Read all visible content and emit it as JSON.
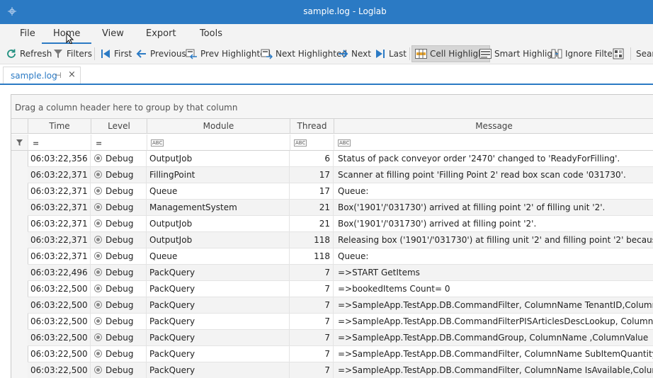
{
  "window": {
    "title": "sample.log - Loglab"
  },
  "menu": {
    "items": [
      "File",
      "Home",
      "View",
      "Export",
      "Tools"
    ],
    "active": "Home"
  },
  "toolbar": {
    "refresh": "Refresh",
    "filters": "Filters",
    "first": "First",
    "previous": "Previous",
    "prev_highlighted": "Prev Highlighted",
    "next_highlighted": "Next Highlighted",
    "next": "Next",
    "last": "Last",
    "cell_highlight": "Cell Highlight",
    "smart_highlight": "Smart Highlight",
    "ignore_filter": "Ignore Filter",
    "search": "Search"
  },
  "tab": {
    "label": "sample.log"
  },
  "grid": {
    "group_prompt": "Drag a column header here to group by that column",
    "columns": [
      "Time",
      "Level",
      "Module",
      "Thread",
      "Message"
    ],
    "rows": [
      {
        "time": "06:03:22,356",
        "level": "Debug",
        "module": "OutputJob",
        "thread": "6",
        "message": "Status of pack conveyor order '2470' changed to 'ReadyForFilling'."
      },
      {
        "time": "06:03:22,371",
        "level": "Debug",
        "module": "FillingPoint",
        "thread": "17",
        "message": "Scanner at filling point 'Filling Point 2' read box scan code '031730'."
      },
      {
        "time": "06:03:22,371",
        "level": "Debug",
        "module": "Queue",
        "thread": "17",
        "message": "Queue:"
      },
      {
        "time": "06:03:22,371",
        "level": "Debug",
        "module": "ManagementSystem",
        "thread": "21",
        "message": "Box('1901'/'031730') arrived at filling point '2' of filling unit '2'."
      },
      {
        "time": "06:03:22,371",
        "level": "Debug",
        "module": "OutputJob",
        "thread": "21",
        "message": "Box('1901'/'031730') arrived at filling point '2'."
      },
      {
        "time": "06:03:22,371",
        "level": "Debug",
        "module": "OutputJob",
        "thread": "118",
        "message": "Releasing box ('1901'/'031730') at filling unit '2' and filling point '2' because it is n"
      },
      {
        "time": "06:03:22,371",
        "level": "Debug",
        "module": "Queue",
        "thread": "118",
        "message": "Queue:"
      },
      {
        "time": "06:03:22,496",
        "level": "Debug",
        "module": "PackQuery",
        "thread": "7",
        "message": "=>START GetItems"
      },
      {
        "time": "06:03:22,500",
        "level": "Debug",
        "module": "PackQuery",
        "thread": "7",
        "message": "=>bookedItems Count= 0"
      },
      {
        "time": "06:03:22,500",
        "level": "Debug",
        "module": "PackQuery",
        "thread": "7",
        "message": "=>SampleApp.TestApp.DB.CommandFilter, ColumnName TenantID,ColumnValue"
      },
      {
        "time": "06:03:22,500",
        "level": "Debug",
        "module": "PackQuery",
        "thread": "7",
        "message": "=>SampleApp.TestApp.DB.CommandFilterPISArticlesDescLookup, ColumnName ,C"
      },
      {
        "time": "06:03:22,500",
        "level": "Debug",
        "module": "PackQuery",
        "thread": "7",
        "message": "=>SampleApp.TestApp.DB.CommandGroup, ColumnName ,ColumnValue"
      },
      {
        "time": "06:03:22,500",
        "level": "Debug",
        "module": "PackQuery",
        "thread": "7",
        "message": "=>SampleApp.TestApp.DB.CommandFilter, ColumnName SubItemQuantity,Colum"
      },
      {
        "time": "06:03:22,500",
        "level": "Debug",
        "module": "PackQuery",
        "thread": "7",
        "message": "=>SampleApp.TestApp.DB.CommandFilter, ColumnName IsAvailable,ColumnValue"
      }
    ]
  },
  "colors": {
    "accent": "#2b7ac4",
    "alt_row": "#f3f3f3"
  }
}
